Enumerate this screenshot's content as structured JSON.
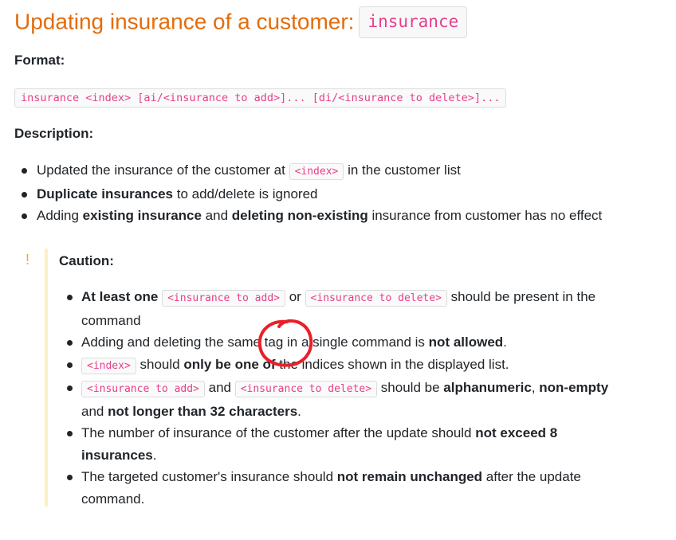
{
  "heading": {
    "text": "Updating insurance of a customer:",
    "command": "insurance"
  },
  "format": {
    "label": "Format:",
    "code": "insurance <index> [ai/<insurance to add>]... [di/<insurance to delete>]..."
  },
  "description": {
    "label": "Description:",
    "items": [
      {
        "t1": "Updated the insurance of the customer at ",
        "c1": "<index>",
        "t2": " in the customer list"
      },
      {
        "b1": "Duplicate insurances",
        "t1": " to add/delete is ignored"
      },
      {
        "t1": "Adding ",
        "b1": "existing insurance",
        "t2": " and ",
        "b2": "deleting non-existing",
        "t3": " insurance from customer has no effect"
      }
    ]
  },
  "caution": {
    "mark": "!",
    "title": "Caution:",
    "items": [
      {
        "b1": "At least one",
        "t1": " ",
        "c1": "<insurance to add>",
        "t2": " or ",
        "c2": "<insurance to delete>",
        "t3": " should be present in the command"
      },
      {
        "t1": "Adding and deleting the same tag in a single command is ",
        "b1": "not allowed",
        "t2": "."
      },
      {
        "c1": "<index>",
        "t1": " should ",
        "b1": "only be one of",
        "t2": " the indices shown in the displayed list."
      },
      {
        "c1": "<insurance to add>",
        "t1": " and ",
        "c2": "<insurance to delete>",
        "t2": " should be ",
        "b1": "alphanumeric",
        "t3": ", ",
        "b2": "non-empty",
        "t4": " and ",
        "b3": "not longer than 32 characters",
        "t5": "."
      },
      {
        "t1": "The number of insurance of the customer after the update should ",
        "b1": "not exceed 8 insurances",
        "t2": "."
      },
      {
        "t1": "The targeted customer's insurance should ",
        "b1": "not remain unchanged",
        "t2": " after the update command."
      }
    ]
  },
  "colors": {
    "heading": "#e46c0a",
    "code": "#e83e8c",
    "caution_bar": "#fdf1bd",
    "caution_mark": "#f0ad1a",
    "annotation": "#e8202a"
  }
}
